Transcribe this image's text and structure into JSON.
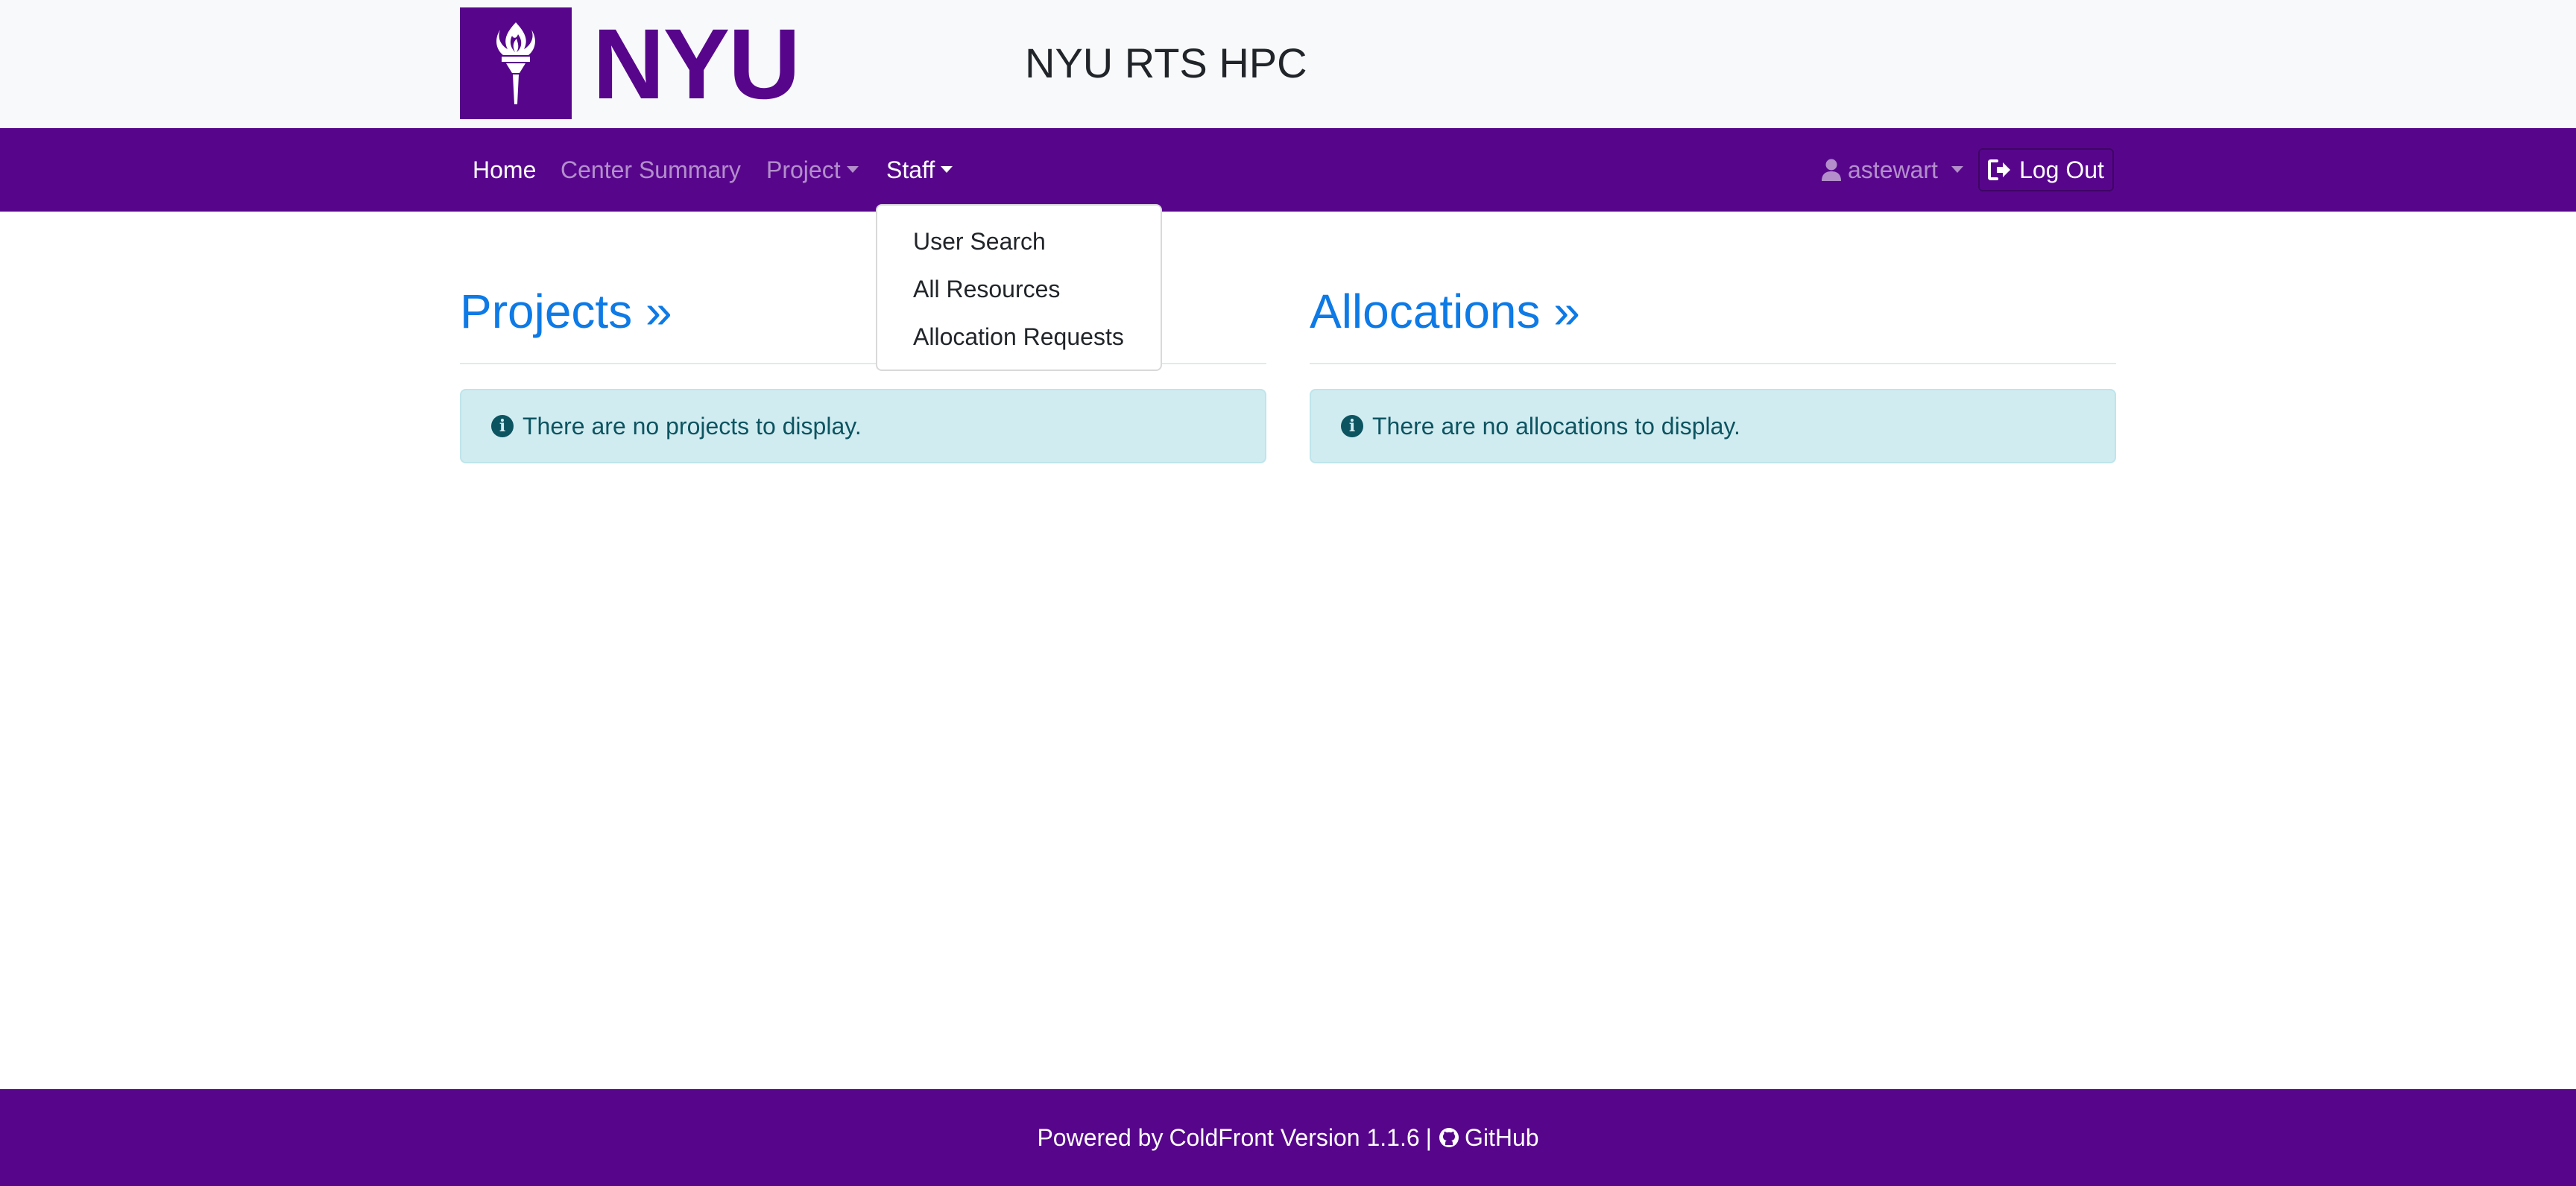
{
  "header": {
    "logo_text": "NYU",
    "site_title": "NYU RTS HPC"
  },
  "navbar": {
    "home": "Home",
    "center_summary": "Center Summary",
    "project": "Project",
    "staff": "Staff",
    "user": "astewart",
    "logout": "Log Out"
  },
  "staff_menu": {
    "items": [
      "User Search",
      "All Resources",
      "Allocation Requests"
    ]
  },
  "projects": {
    "title": "Projects »",
    "empty_message": "There are no projects to display."
  },
  "allocations": {
    "title": "Allocations »",
    "empty_message": "There are no allocations to display."
  },
  "footer": {
    "powered_by": "Powered by",
    "coldfront_link": "ColdFront Version 1.1.6",
    "separator": "|",
    "github_link": "GitHub"
  },
  "colors": {
    "brand_purple": "#57068c",
    "link_blue": "#0d7ae6",
    "alert_bg": "#d1ecf1",
    "alert_text": "#0c5460"
  }
}
